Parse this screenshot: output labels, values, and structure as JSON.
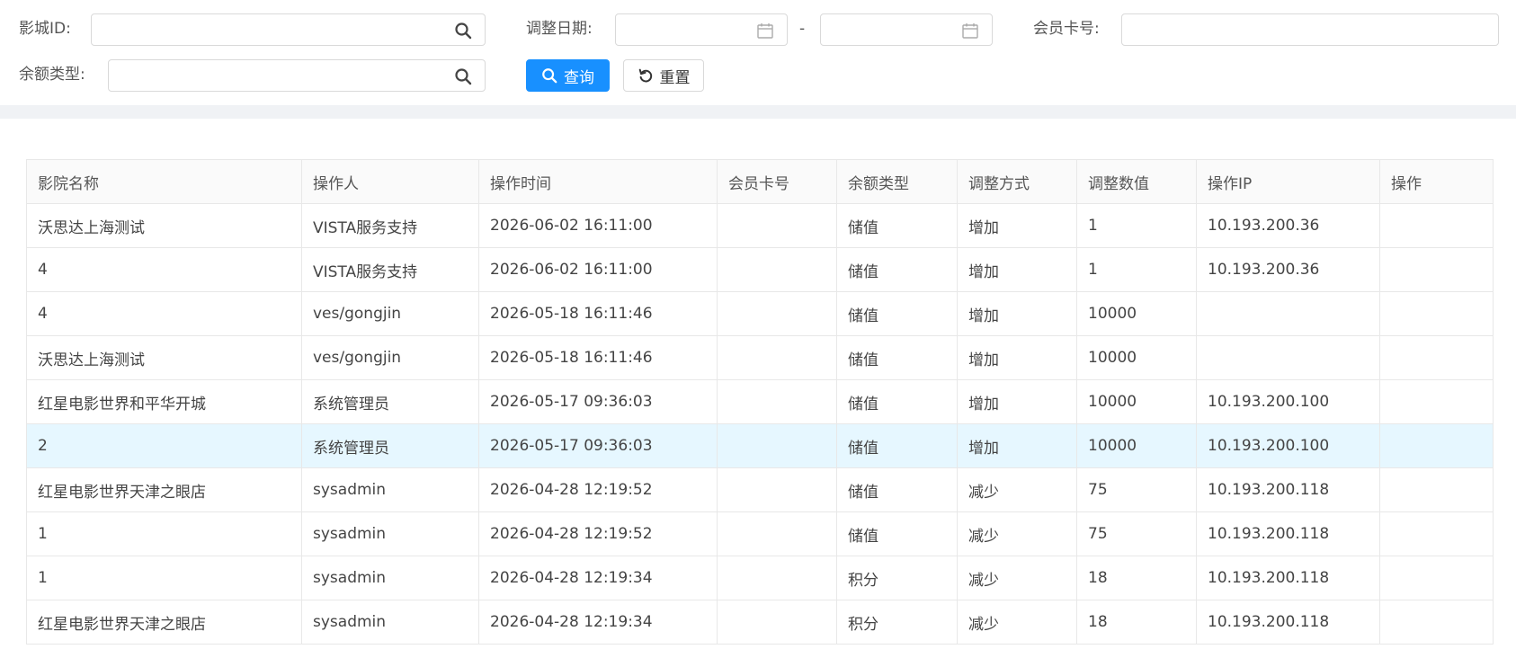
{
  "filters": {
    "cinema_id_label": "影城ID:",
    "adjust_date_label": "调整日期:",
    "date_separator": "-",
    "member_card_label": "会员卡号:",
    "balance_type_label": "余额类型:",
    "cinema_id_value": "",
    "date_start_value": "",
    "date_end_value": "",
    "member_card_value": "",
    "balance_type_value": ""
  },
  "buttons": {
    "query_label": "查询",
    "reset_label": "重置"
  },
  "colors": {
    "primary": "#1890ff",
    "highlight_row": "#e6f7ff"
  },
  "table": {
    "columns": [
      "影院名称",
      "操作人",
      "操作时间",
      "会员卡号",
      "余额类型",
      "调整方式",
      "调整数值",
      "操作IP",
      "操作"
    ],
    "highlighted_row": 5,
    "rows": [
      [
        "沃思达上海测试",
        "VISTA服务支持",
        "2026-06-02 16:11:00",
        "",
        "储值",
        "增加",
        "1",
        "10.193.200.36",
        ""
      ],
      [
        "4",
        "VISTA服务支持",
        "2026-06-02 16:11:00",
        "",
        "储值",
        "增加",
        "1",
        "10.193.200.36",
        ""
      ],
      [
        "4",
        "ves/gongjin",
        "2026-05-18 16:11:46",
        "",
        "储值",
        "增加",
        "10000",
        "",
        ""
      ],
      [
        "沃思达上海测试",
        "ves/gongjin",
        "2026-05-18 16:11:46",
        "",
        "储值",
        "增加",
        "10000",
        "",
        ""
      ],
      [
        "红星电影世界和平华开城",
        "系统管理员",
        "2026-05-17 09:36:03",
        "",
        "储值",
        "增加",
        "10000",
        "10.193.200.100",
        ""
      ],
      [
        "2",
        "系统管理员",
        "2026-05-17 09:36:03",
        "",
        "储值",
        "增加",
        "10000",
        "10.193.200.100",
        ""
      ],
      [
        "红星电影世界天津之眼店",
        "sysadmin",
        "2026-04-28 12:19:52",
        "",
        "储值",
        "减少",
        "75",
        "10.193.200.118",
        ""
      ],
      [
        "1",
        "sysadmin",
        "2026-04-28 12:19:52",
        "",
        "储值",
        "减少",
        "75",
        "10.193.200.118",
        ""
      ],
      [
        "1",
        "sysadmin",
        "2026-04-28 12:19:34",
        "",
        "积分",
        "减少",
        "18",
        "10.193.200.118",
        ""
      ],
      [
        "红星电影世界天津之眼店",
        "sysadmin",
        "2026-04-28 12:19:34",
        "",
        "积分",
        "减少",
        "18",
        "10.193.200.118",
        ""
      ]
    ]
  }
}
